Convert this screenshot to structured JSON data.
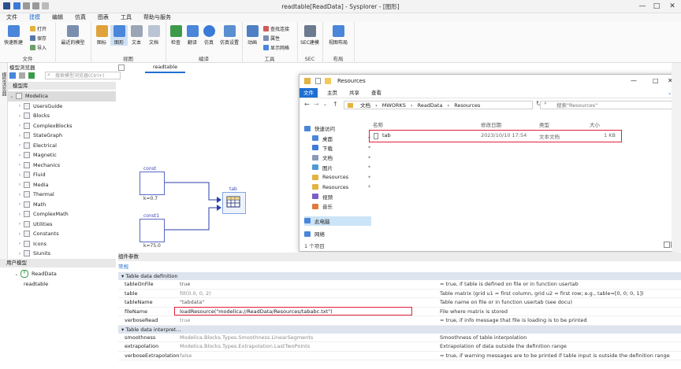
{
  "window": {
    "title": "readtable[ReadData] - Sysplorer - [图形]",
    "win_buttons": [
      "—",
      "□",
      "✕"
    ]
  },
  "menu": {
    "items": [
      "文件",
      "建模",
      "编辑",
      "仿真",
      "图表",
      "工具",
      "帮助与服务"
    ],
    "active": 1
  },
  "ribbon": {
    "groups": [
      {
        "label": "文件",
        "big": "快速新建",
        "small": [
          "打开",
          "保存",
          "导入"
        ]
      },
      {
        "label": "",
        "big": "最近的模型",
        "small": []
      },
      {
        "label": "视图",
        "big_list": [
          "图标",
          "图形",
          "文本",
          "文档"
        ]
      },
      {
        "label": "编译",
        "big_list": [
          "检查",
          "翻译",
          "仿真",
          "仿真设置"
        ]
      },
      {
        "label": "工具",
        "big": "动画",
        "small": [
          "查找连接",
          "属性",
          "显示网格"
        ]
      },
      {
        "label": "SEC",
        "big": "SEC建模",
        "small": []
      },
      {
        "label": "布局",
        "big": "视图布局",
        "small": []
      }
    ]
  },
  "left_panel": {
    "title": "模型浏览器",
    "vertical_tab": "模型浏览器",
    "search_placeholder": "搜索模型浏览器(Ctrl+)",
    "lib_header": "模型库",
    "tree": [
      "Modelica",
      "UsersGuide",
      "Blocks",
      "ComplexBlocks",
      "StateGraph",
      "Electrical",
      "Magnetic",
      "Mechanics",
      "Fluid",
      "Media",
      "Thermal",
      "Math",
      "ComplexMath",
      "Utilities",
      "Constants",
      "Icons",
      "SIunits"
    ],
    "user_header": "用户模型",
    "user_tree": [
      "ReadData",
      "readtable"
    ]
  },
  "canvas": {
    "tab": "readtable",
    "blocks": [
      {
        "name": "const",
        "value": "k=0.7"
      },
      {
        "name": "const1",
        "value": "k=75.0"
      },
      {
        "name": "tab",
        "value": ""
      }
    ]
  },
  "explorer": {
    "title": "Resources",
    "tabs": [
      "文件",
      "主页",
      "共享",
      "查看"
    ],
    "address": [
      "文档",
      "MWORKS",
      "ReadData",
      "Resources"
    ],
    "search_placeholder": "搜索\"Resources\"",
    "sidebar": [
      "快速访问",
      "桌面",
      "下载",
      "文档",
      "图片",
      "Resources",
      "Resources",
      "视频",
      "音乐",
      "此电脑",
      "网络"
    ],
    "columns": [
      "名称",
      "修改日期",
      "类型",
      "大小"
    ],
    "files": [
      {
        "name": "tab",
        "date": "2023/10/10 17:54",
        "type": "文本文档",
        "size": "1 KB"
      }
    ],
    "status": "1 个项目"
  },
  "params": {
    "header": "组件参数",
    "tab": "常规",
    "section1": "Table data definition",
    "section2": "Table data interpret...",
    "rows1": [
      {
        "name": "tableOnFile",
        "value": "true",
        "desc": "= true, if table is defined on file or in function usertab"
      },
      {
        "name": "table",
        "value": "fill(0.0, 0, 2)",
        "desc": "Table matrix (grid u1 = first column, grid u2 = first row; e.g., table=[0, 0; 0, 1])"
      },
      {
        "name": "tableName",
        "value": "\"tabdata\"",
        "desc": "Table name on file or in function usertab (see docu)"
      },
      {
        "name": "fileName",
        "value": "loadResource(\"modelica://ReadData/Resources/tababc.txt\")",
        "desc": "File where matrix is stored"
      },
      {
        "name": "verboseRead",
        "value": "true",
        "desc": "= true, if info message that file is loading is to be printed"
      }
    ],
    "rows2": [
      {
        "name": "smoothness",
        "value": "Modelica.Blocks.Types.Smoothness.LinearSegments",
        "desc": "Smoothness of table interpolation"
      },
      {
        "name": "extrapolation",
        "value": "Modelica.Blocks.Types.Extrapolation.LastTwoPoints",
        "desc": "Extrapolation of data outside the definition range"
      },
      {
        "name": "verboseExtrapolation",
        "value": "false",
        "desc": "= true, if warning messages are to be printed if table input is outside the definition range"
      }
    ]
  }
}
